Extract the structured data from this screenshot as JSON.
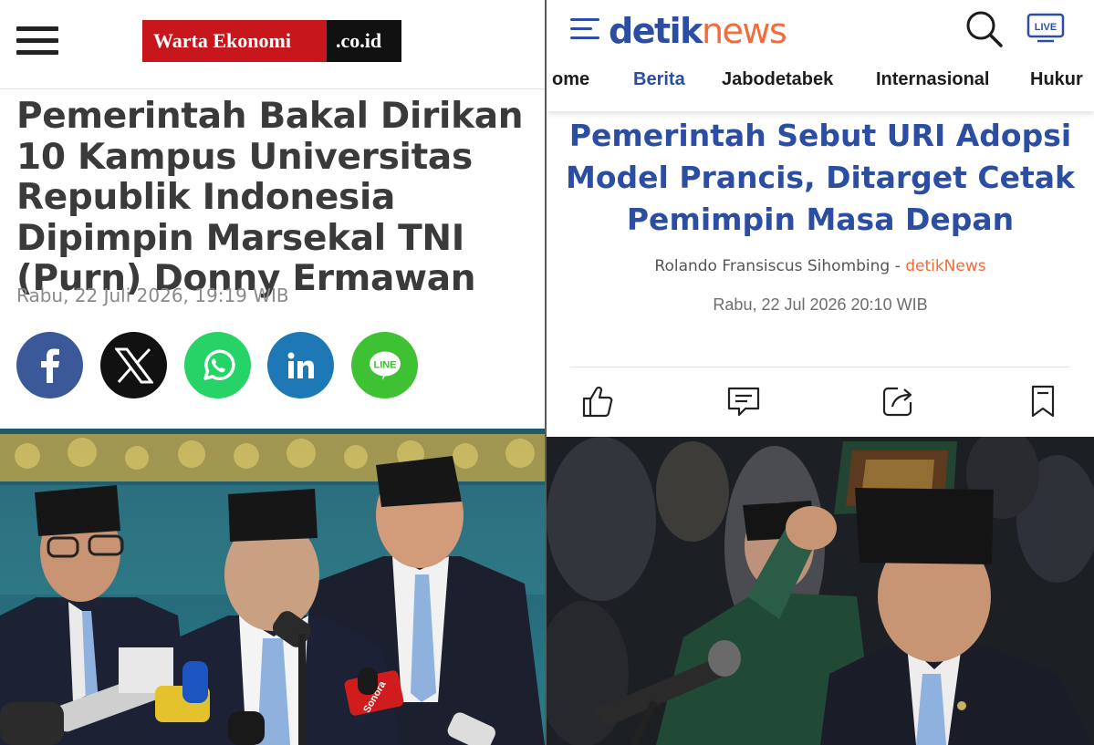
{
  "left": {
    "logo": {
      "brand": "Warta Ekonomi",
      "suffix": ".co.id",
      "brand_bg": "#c8161d",
      "suffix_bg": "#111111"
    },
    "title": "Pemerintah Bakal Dirikan 10 Kampus Universitas Republik Indonesia Dipimpin Marsekal TNI (Purn) Donny Ermawan",
    "date": "Rabu, 22 Juli 2026, 19:19 WIB",
    "share": [
      {
        "name": "facebook",
        "icon": "facebook-icon",
        "color": "#3b5998"
      },
      {
        "name": "x",
        "icon": "x-icon",
        "color": "#111111"
      },
      {
        "name": "whatsapp",
        "icon": "whatsapp-icon",
        "color": "#25d366"
      },
      {
        "name": "linkedin",
        "icon": "linkedin-icon",
        "color": "#1e78b6"
      },
      {
        "name": "line",
        "icon": "line-icon",
        "color": "#3ec133"
      }
    ],
    "photo_mic_labels": [
      "Sonora"
    ]
  },
  "right": {
    "logo": {
      "part1": "detik",
      "part2": "news",
      "primary": "#2b4ea2",
      "accent": "#f26b3a"
    },
    "live_label": "LIVE",
    "nav": [
      {
        "label": "Home",
        "visible": "ome",
        "active": false
      },
      {
        "label": "Berita",
        "visible": "Berita",
        "active": true
      },
      {
        "label": "Jabodetabek",
        "visible": "Jabodetabek",
        "active": false
      },
      {
        "label": "Internasional",
        "visible": "Internasional",
        "active": false
      },
      {
        "label": "Hukum",
        "visible": "Hukur",
        "active": false
      }
    ],
    "title": "Pemerintah Sebut URI Adopsi Model Prancis, Ditarget Cetak Pemimpin Masa Depan",
    "author": "Rolando Fransiscus Sihombing",
    "author_sep": " - ",
    "source": "detikNews",
    "date": "Rabu, 22 Jul 2026 20:10 WIB",
    "actions": [
      "like-icon",
      "comment-icon",
      "share-icon",
      "bookmark-icon"
    ]
  }
}
